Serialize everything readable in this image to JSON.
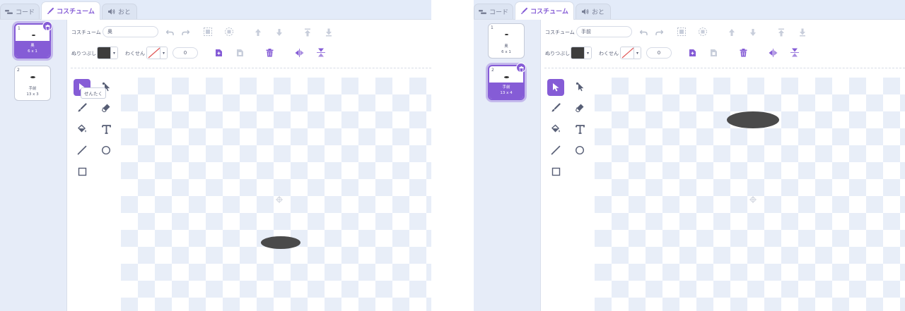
{
  "tabs": {
    "code": "コード",
    "costume": "コスチューム",
    "sound": "おと"
  },
  "labels": {
    "costume": "コスチューム",
    "fill": "ぬりつぶし",
    "outline": "わくせん",
    "select_tooltip": "せんたく"
  },
  "colors": {
    "accent": "#855cd6",
    "fill": "#3d3d3d",
    "shape": "#4a4a4a"
  },
  "icons": [
    "code-icon",
    "brush-icon",
    "speaker-icon",
    "trash-icon",
    "undo-icon",
    "redo-icon",
    "group-icon",
    "ungroup-icon",
    "forward-icon",
    "backward-icon",
    "front-icon",
    "back-icon",
    "copy-icon",
    "paste-icon",
    "delete-icon",
    "flip-horizontal-icon",
    "flip-vertical-icon",
    "select-arrow-icon",
    "reshape-icon",
    "brush-tool-icon",
    "eraser-icon",
    "fill-bucket-icon",
    "text-icon",
    "line-icon",
    "circle-icon",
    "rectangle-icon",
    "crosshair-icon"
  ],
  "editors": [
    {
      "costume_name": "奥",
      "outline_width": "0",
      "selected_index": 0,
      "costumes": [
        {
          "num": "1",
          "name": "奥",
          "size": "6 x 1"
        },
        {
          "num": "2",
          "name": "手前",
          "size": "13 x 3"
        }
      ],
      "tooltip_visible": true,
      "active_tool": "select"
    },
    {
      "costume_name": "手前",
      "outline_width": "0",
      "selected_index": 1,
      "costumes": [
        {
          "num": "1",
          "name": "奥",
          "size": "6 x 1"
        },
        {
          "num": "2",
          "name": "手前",
          "size": "13 x 4"
        }
      ],
      "tooltip_visible": false,
      "active_tool": "select"
    }
  ]
}
